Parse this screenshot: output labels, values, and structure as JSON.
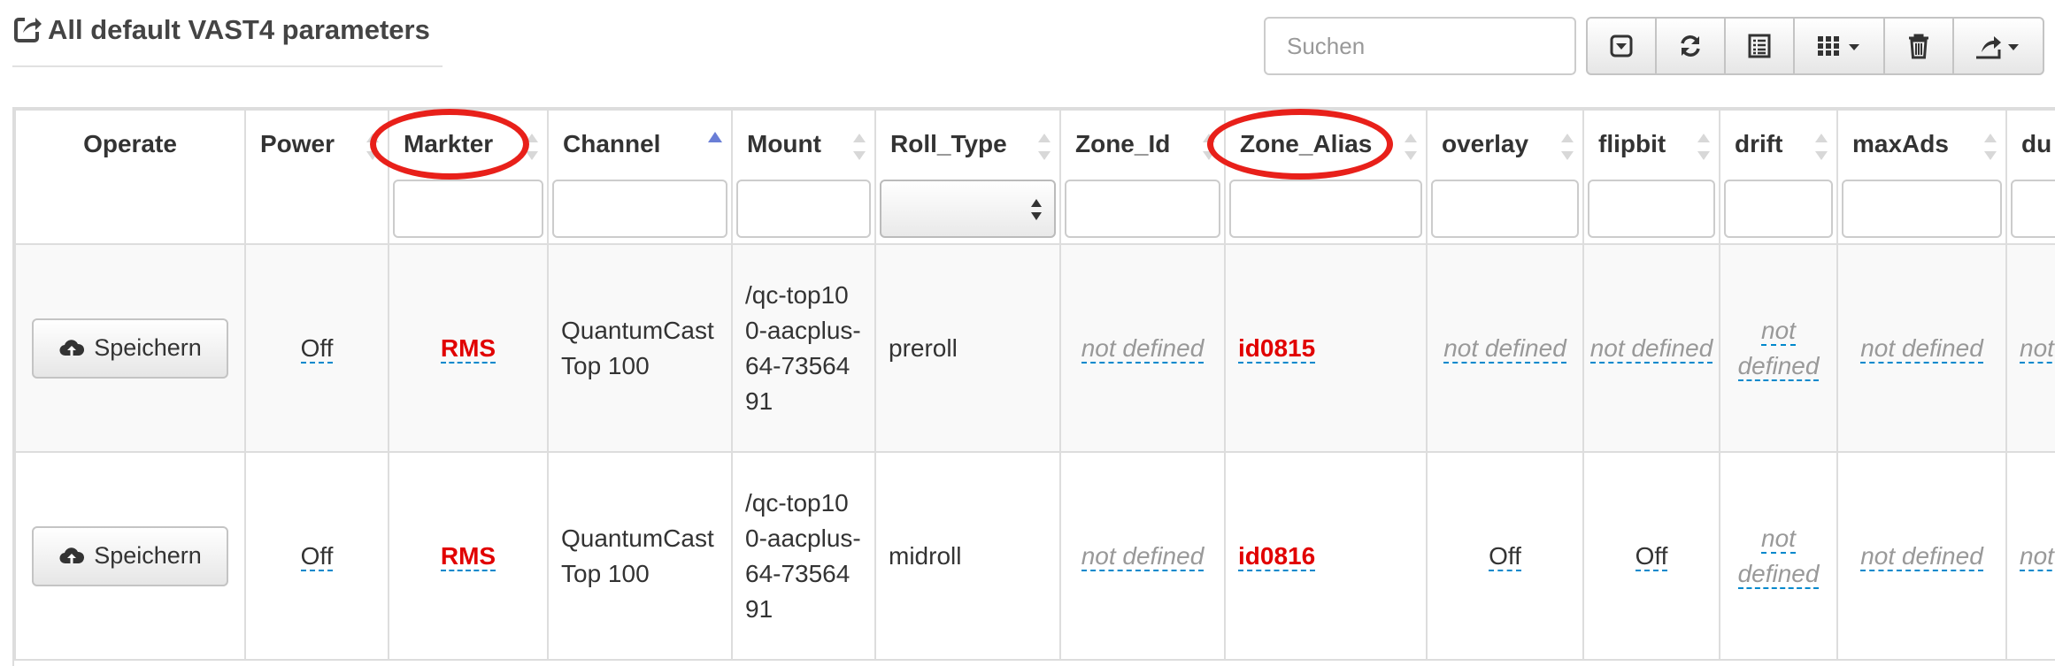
{
  "page": {
    "title": "All default VAST4 parameters"
  },
  "search": {
    "placeholder": "Suchen"
  },
  "toolbar": {
    "buttons": [
      {
        "icon": "toggle-pagination-icon"
      },
      {
        "icon": "refresh-icon"
      },
      {
        "icon": "card-view-icon"
      },
      {
        "icon": "columns-icon"
      },
      {
        "icon": "delete-icon"
      },
      {
        "icon": "export-icon"
      }
    ]
  },
  "table": {
    "headers": {
      "operate": "Operate",
      "power": "Power",
      "markter": "Markter",
      "channel": "Channel",
      "mount": "Mount",
      "roll_type": "Roll_Type",
      "zone_id": "Zone_Id",
      "zone_alias": "Zone_Alias",
      "overlay": "overlay",
      "flipbit": "flipbit",
      "drift": "drift",
      "maxads": "maxAds",
      "du": "du"
    },
    "sorted_column": "Channel",
    "highlighted_columns": [
      "Markter",
      "Zone_Alias"
    ],
    "rows": [
      {
        "operate": "Speichern",
        "power": "Off",
        "markter": "RMS",
        "channel": "QuantumCast Top 100",
        "mount": "/qc-top100-aacplus-64-7356491",
        "roll_type": "preroll",
        "zone_id": "not defined",
        "zone_alias": "id0815",
        "overlay": "not defined",
        "flipbit": "not defined",
        "drift": "not defined",
        "maxads": "not defined",
        "du": "not defined"
      },
      {
        "operate": "Speichern",
        "power": "Off",
        "markter": "RMS",
        "channel": "QuantumCast Top 100",
        "mount": "/qc-top100-aacplus-64-7356491",
        "roll_type": "midroll",
        "zone_id": "not defined",
        "zone_alias": "id0816",
        "overlay": "Off",
        "flipbit": "Off",
        "drift": "not defined",
        "maxads": "not defined",
        "du": "not defined"
      }
    ]
  },
  "colors": {
    "highlight": "#e8201a",
    "link": "#0088cc",
    "red_value": "#e10000"
  }
}
